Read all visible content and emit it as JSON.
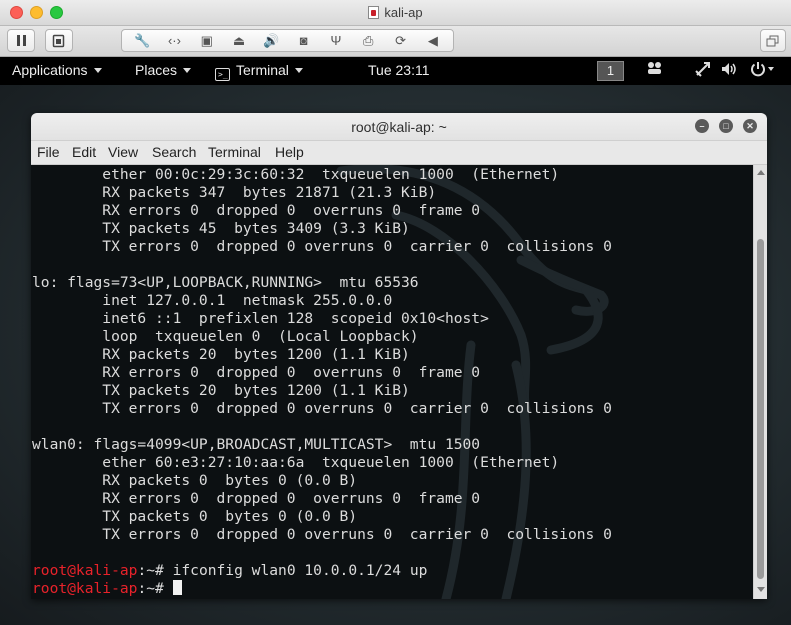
{
  "vm": {
    "window_title": "kali-ap",
    "toolbar_icons": [
      "pause-icon",
      "snapshot-icon",
      "settings-icon",
      "network-icon",
      "harddisk-icon",
      "optical-drive-icon",
      "sound-icon",
      "camera-icon",
      "usb-icon",
      "printer-icon",
      "sync-icon",
      "collapse-arrow-icon",
      "restore-window-icon"
    ]
  },
  "topbar": {
    "applications": "Applications",
    "places": "Places",
    "terminal": "Terminal",
    "clock": "Tue 23:11",
    "workspace": "1"
  },
  "terminal": {
    "title": "root@kali-ap: ~",
    "menu": {
      "file": "File",
      "edit": "Edit",
      "view": "View",
      "search": "Search",
      "terminal": "Terminal",
      "help": "Help"
    },
    "lines": [
      "        ether 00:0c:29:3c:60:32  txqueuelen 1000  (Ethernet)",
      "        RX packets 347  bytes 21871 (21.3 KiB)",
      "        RX errors 0  dropped 0  overruns 0  frame 0",
      "        TX packets 45  bytes 3409 (3.3 KiB)",
      "        TX errors 0  dropped 0 overruns 0  carrier 0  collisions 0",
      "",
      "lo: flags=73<UP,LOOPBACK,RUNNING>  mtu 65536",
      "        inet 127.0.0.1  netmask 255.0.0.0",
      "        inet6 ::1  prefixlen 128  scopeid 0x10<host>",
      "        loop  txqueuelen 0  (Local Loopback)",
      "        RX packets 20  bytes 1200 (1.1 KiB)",
      "        RX errors 0  dropped 0  overruns 0  frame 0",
      "        TX packets 20  bytes 1200 (1.1 KiB)",
      "        TX errors 0  dropped 0 overruns 0  carrier 0  collisions 0",
      "",
      "wlan0: flags=4099<UP,BROADCAST,MULTICAST>  mtu 1500",
      "        ether 60:e3:27:10:aa:6a  txqueuelen 1000  (Ethernet)",
      "        RX packets 0  bytes 0 (0.0 B)",
      "        RX errors 0  dropped 0  overruns 0  frame 0",
      "        TX packets 0  bytes 0 (0.0 B)",
      "        TX errors 0  dropped 0 overruns 0  carrier 0  collisions 0",
      ""
    ],
    "prompt_user": "root@kali-ap",
    "prompt_rest": ":~# ",
    "command": "ifconfig wlan0 10.0.0.1/24 up",
    "prompt_color": "#e8222a"
  }
}
